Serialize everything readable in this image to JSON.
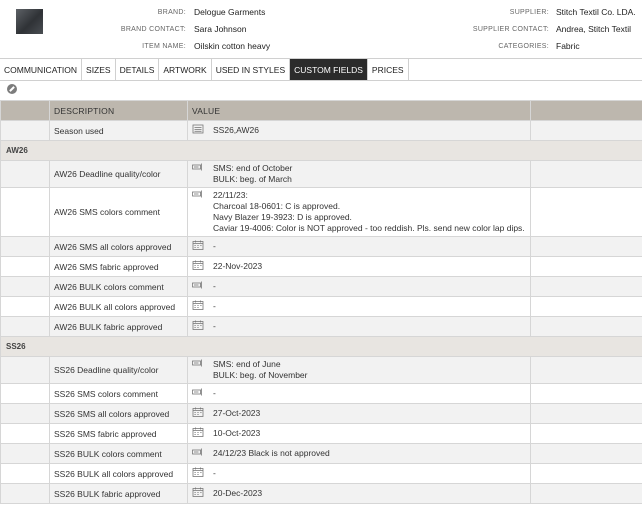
{
  "header": {
    "brand_label": "BRAND:",
    "brand": "Delogue Garments",
    "brand_contact_label": "BRAND CONTACT:",
    "brand_contact": "Sara Johnson",
    "item_name_label": "ITEM NAME:",
    "item_name": "Oilskin cotton heavy",
    "supplier_label": "SUPPLIER:",
    "supplier": "Stitch Textil Co. LDA.",
    "supplier_contact_label": "SUPPLIER CONTACT:",
    "supplier_contact": "Andrea, Stitch Textil",
    "categories_label": "CATEGORIES:",
    "categories": "Fabric"
  },
  "tabs": [
    {
      "label": "COMMUNICATION"
    },
    {
      "label": "SIZES"
    },
    {
      "label": "DETAILS"
    },
    {
      "label": "ARTWORK"
    },
    {
      "label": "USED IN STYLES"
    },
    {
      "label": "CUSTOM FIELDS",
      "active": true
    },
    {
      "label": "PRICES"
    }
  ],
  "table": {
    "col_description": "DESCRIPTION",
    "col_value": "VALUE",
    "rows": [
      {
        "type": "row",
        "desc": "Season used",
        "icon": "list-icon",
        "value": "SS26,AW26"
      },
      {
        "type": "group",
        "label": "AW26"
      },
      {
        "type": "row",
        "desc": "AW26 Deadline quality/color",
        "icon": "text-icon",
        "value": "SMS: end of October\nBULK: beg. of March"
      },
      {
        "type": "row",
        "desc": "AW26 SMS colors comment",
        "icon": "text-icon",
        "value": "22/11/23:\nCharcoal 18-0601: C is approved.\nNavy Blazer 19-3923: D is approved.\nCaviar 19-4006: Color is NOT approved - too reddish. Pls. send new color lap dips."
      },
      {
        "type": "row",
        "desc": "AW26 SMS all colors approved",
        "icon": "calendar-icon",
        "value": "-"
      },
      {
        "type": "row",
        "desc": "AW26 SMS fabric approved",
        "icon": "calendar-icon",
        "value": "22-Nov-2023"
      },
      {
        "type": "row",
        "desc": "AW26 BULK colors comment",
        "icon": "text-icon",
        "value": "-"
      },
      {
        "type": "row",
        "desc": "AW26 BULK all colors approved",
        "icon": "calendar-icon",
        "value": "-"
      },
      {
        "type": "row",
        "desc": "AW26 BULK fabric approved",
        "icon": "calendar-icon",
        "value": "-"
      },
      {
        "type": "group",
        "label": "SS26"
      },
      {
        "type": "row",
        "desc": "SS26 Deadline quality/color",
        "icon": "text-icon",
        "value": "SMS: end of June\nBULK: beg. of November"
      },
      {
        "type": "row",
        "desc": "SS26 SMS colors comment",
        "icon": "text-icon",
        "value": "-"
      },
      {
        "type": "row",
        "desc": "SS26 SMS all colors approved",
        "icon": "calendar-icon",
        "value": "27-Oct-2023"
      },
      {
        "type": "row",
        "desc": "SS26 SMS fabric approved",
        "icon": "calendar-icon",
        "value": "10-Oct-2023"
      },
      {
        "type": "row",
        "desc": "SS26 BULK colors comment",
        "icon": "text-icon",
        "value": "24/12/23 Black is not approved"
      },
      {
        "type": "row",
        "desc": "SS26 BULK all colors approved",
        "icon": "calendar-icon",
        "value": "-"
      },
      {
        "type": "row",
        "desc": "SS26 BULK fabric approved",
        "icon": "calendar-icon",
        "value": "20-Dec-2023"
      }
    ]
  }
}
